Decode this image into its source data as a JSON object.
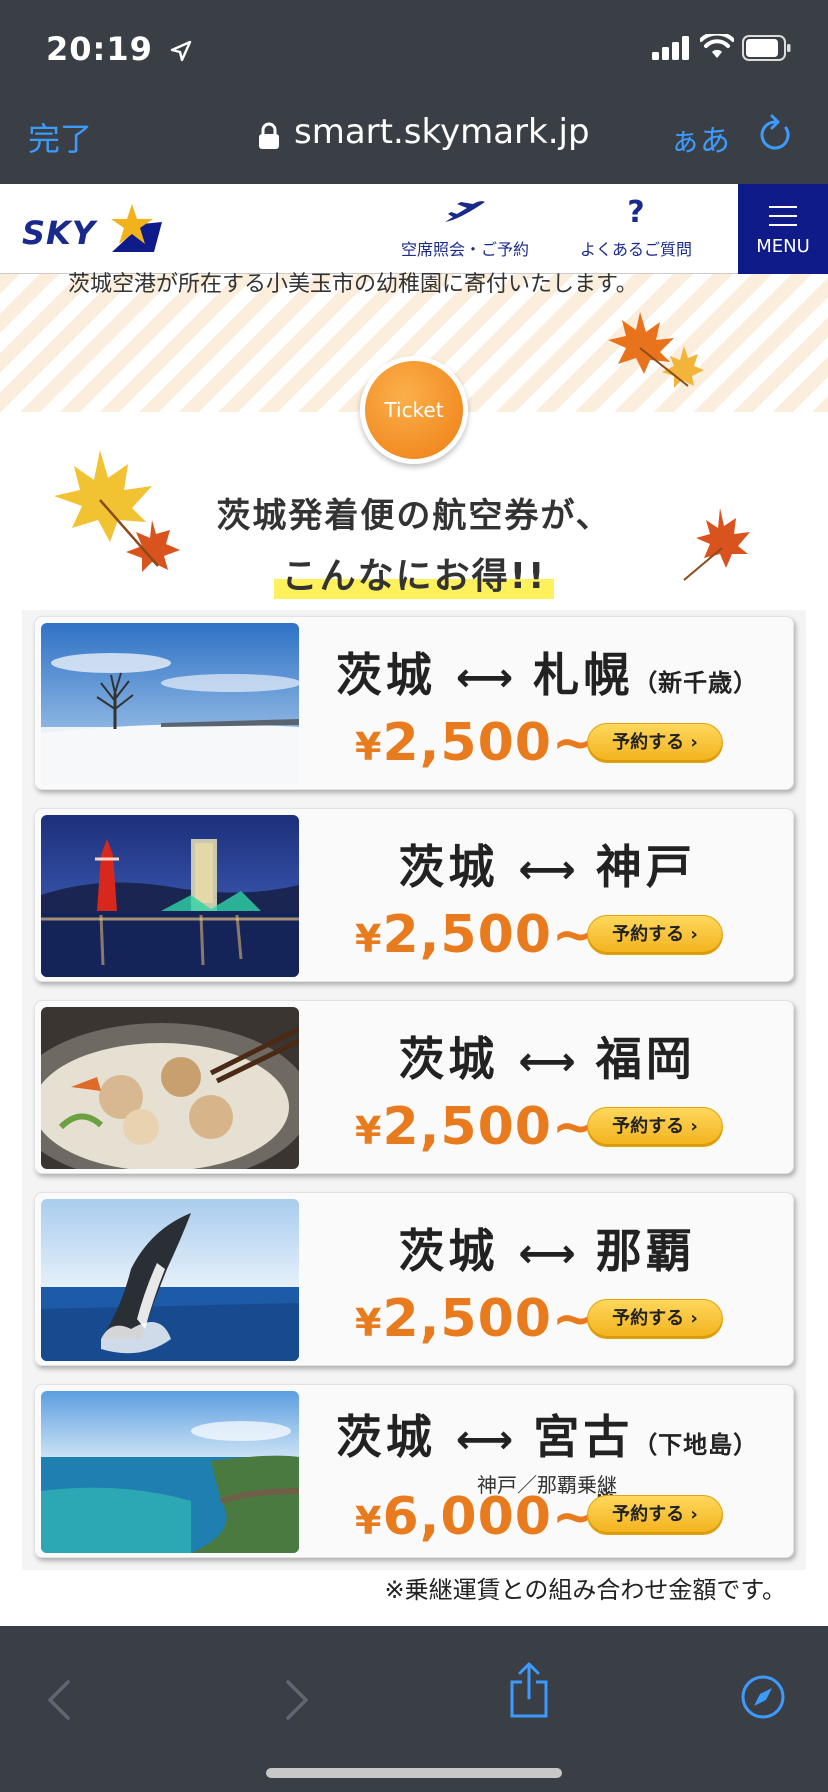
{
  "status_bar": {
    "time": "20:19"
  },
  "browser": {
    "done_label": "完了",
    "url": "smart.skymark.jp",
    "text_size_label": "ぁあ"
  },
  "site_header": {
    "logo_text": "SKY",
    "nav": [
      {
        "label": "空席照会・ご予約",
        "icon": "airplane-icon"
      },
      {
        "label": "よくあるご質問",
        "icon": "question-icon",
        "glyph": "?"
      }
    ],
    "menu_label": "MENU",
    "colors": {
      "brand_navy": "#101b8a",
      "accent_yellow": "#f2b21c"
    }
  },
  "banner": {
    "partial_text": "茨城空港が所在する小美玉市の幼稚園に寄付いたします。",
    "ticket_badge": "Ticket",
    "headline_line1": "茨城発着便の航空券が、",
    "headline_line2": "こんなにお得!!"
  },
  "routes": [
    {
      "from": "茨城",
      "arrow": "⟷",
      "to": "札幌",
      "note": "（新千歳）",
      "transfer": "",
      "currency": "¥",
      "price": "2,500~",
      "mark": "",
      "button": "予約する",
      "photo": "snowy-field-tree"
    },
    {
      "from": "茨城",
      "arrow": "⟷",
      "to": "神戸",
      "note": "",
      "transfer": "",
      "currency": "¥",
      "price": "2,500~",
      "mark": "",
      "button": "予約する",
      "photo": "kobe-port-night"
    },
    {
      "from": "茨城",
      "arrow": "⟷",
      "to": "福岡",
      "note": "",
      "transfer": "",
      "currency": "¥",
      "price": "2,500~",
      "mark": "",
      "button": "予約する",
      "photo": "motsunabe-hotpot"
    },
    {
      "from": "茨城",
      "arrow": "⟷",
      "to": "那覇",
      "note": "",
      "transfer": "",
      "currency": "¥",
      "price": "2,500~",
      "mark": "",
      "button": "予約する",
      "photo": "breaching-whale"
    },
    {
      "from": "茨城",
      "arrow": "⟷",
      "to": "宮古",
      "note": "（下地島）",
      "transfer": "神戸／那覇乗継",
      "currency": "¥",
      "price": "6,000~",
      "mark": "※",
      "button": "予約する",
      "photo": "miyako-coast"
    }
  ],
  "footnote": "※乗継運賃との組み合わせ金額です。",
  "price_color": "#e77b1e"
}
